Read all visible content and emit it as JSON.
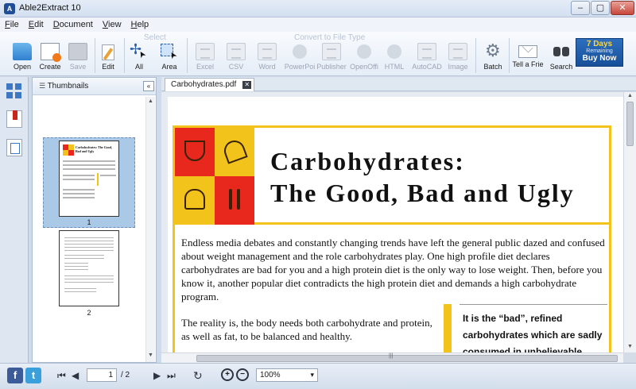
{
  "window": {
    "title": "Able2Extract 10",
    "app_icon": "app-logo-icon"
  },
  "menu": [
    "File",
    "Edit",
    "Document",
    "View",
    "Help"
  ],
  "toolbar": {
    "group_select": "Select",
    "group_convert": "Convert to File Type",
    "buttons": {
      "open": "Open",
      "create": "Create",
      "save": "Save",
      "edit": "Edit",
      "all": "All",
      "area": "Area",
      "excel": "Excel",
      "csv": "CSV",
      "word": "Word",
      "powerpoint": "PowerPoi",
      "publisher": "Publisher",
      "openoffice": "OpenOffi",
      "html": "HTML",
      "autocad": "AutoCAD",
      "image": "Image",
      "batch": "Batch",
      "tell": "Tell a Frie",
      "search": "Search"
    },
    "promo": {
      "line1": "7 Days",
      "line2": "Remaining",
      "line3": "Buy Now"
    }
  },
  "thumbnails": {
    "title": "Thumbnails",
    "collapse_label": "«",
    "pages": [
      "1",
      "2"
    ],
    "mini_title": "Carbohydrates: The Good, Bad and Ugly"
  },
  "document": {
    "tab_label": "Carbohydrates.pdf",
    "title_line1": "Carbohydrates:",
    "title_line2": "The Good, Bad and Ugly",
    "paragraph1": "Endless media debates and constantly changing trends have left the general public dazed and confused about weight management and the role carbohydrates play. One high profile diet declares carbohydrates are bad for you and a high protein diet is the only way to lose weight. Then, before you know it, another popular diet contradicts the high protein diet and demands a high carbohydrate program.",
    "paragraph2": "The reality is, the body needs both carbohydrate and protein, as well as fat, to be balanced and healthy.",
    "callout": "It is the “bad”, refined carbohydrates which are sadly consumed in unbelievable"
  },
  "statusbar": {
    "current_page": "1",
    "total_pages": "/ 2",
    "zoom": "100%"
  },
  "colors": {
    "accent_red": "#e8281c",
    "accent_yellow": "#f2c31a",
    "promo_blue": "#174f99"
  }
}
